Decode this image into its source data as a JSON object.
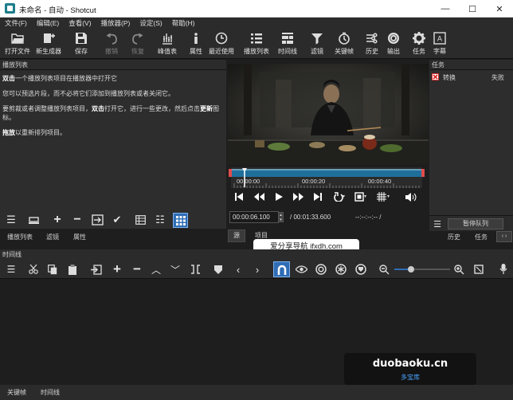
{
  "window": {
    "title": "未命名 - 自动 - Shotcut",
    "min": "—",
    "max": "☐",
    "close": "✕"
  },
  "menu": [
    "文件(F)",
    "编辑(E)",
    "查看(V)",
    "播放器(P)",
    "设定(S)",
    "帮助(H)"
  ],
  "toolbar": [
    {
      "label": "打开文件",
      "icon": "folder-open-icon",
      "enabled": true
    },
    {
      "label": "新生成器",
      "icon": "new-generator-icon",
      "enabled": true
    },
    {
      "label": "保存",
      "icon": "save-icon",
      "enabled": true
    },
    {
      "label": "撤销",
      "icon": "undo-icon",
      "enabled": false
    },
    {
      "label": "恢复",
      "icon": "redo-icon",
      "enabled": false
    },
    {
      "label": "峰值表",
      "icon": "peak-meter-icon",
      "enabled": true
    },
    {
      "label": "属性",
      "icon": "info-icon",
      "enabled": true
    },
    {
      "label": "最近使用",
      "icon": "clock-icon",
      "enabled": true
    },
    {
      "label": "播放列表",
      "icon": "playlist-icon",
      "enabled": true
    },
    {
      "label": "时间线",
      "icon": "timeline-icon",
      "enabled": true
    },
    {
      "label": "滤镜",
      "icon": "filter-icon",
      "enabled": true
    },
    {
      "label": "关键帧",
      "icon": "stopwatch-icon",
      "enabled": true
    },
    {
      "label": "历史",
      "icon": "history-icon",
      "enabled": true
    },
    {
      "label": "输出",
      "icon": "export-icon",
      "enabled": true
    },
    {
      "label": "任务",
      "icon": "gear-icon",
      "enabled": true
    },
    {
      "label": "字幕",
      "icon": "subtitle-icon",
      "enabled": true
    }
  ],
  "playlist": {
    "title": "播放列表",
    "help1_bold": "双击",
    "help1": "一个播放列表项目在播放器中打开它",
    "help2": "您可以预选片段，而不必将它们添加到播放列表或者关闭它。",
    "help3_a": "要剪裁或者调整播放列表项目，",
    "help3_bold": "双击",
    "help3_b": "打开它，进行一些更改，然后点击",
    "help3_bold2": "更新",
    "help3_c": "图标。",
    "help4_bold": "拖放",
    "help4": "以重新排列项目。",
    "tabs": [
      "播放列表",
      "滤镜",
      "属性"
    ]
  },
  "player": {
    "ruler_labels": [
      "00:00:00",
      "00:00:20",
      "00:00:40"
    ],
    "position": "00:00:06.100",
    "duration": "/ 00:01:33.600",
    "in_out": "--:--:--:-- /",
    "progress": 0.07,
    "tabs": [
      "源",
      "项目"
    ]
  },
  "tasks": {
    "title": "任务",
    "job_name": "转换",
    "job_status": "失败",
    "pause_label": "暂停队列",
    "tabs": [
      "历史",
      "任务"
    ]
  },
  "timeline": {
    "title": "时间线",
    "zoom": 0.3
  },
  "bottom_tabs": [
    "关键帧",
    "时间线"
  ],
  "watermark": {
    "center": "爱分享导航 ifxdh.com",
    "brand": "duobaoku.cn",
    "brand_sub": "多宝库"
  }
}
